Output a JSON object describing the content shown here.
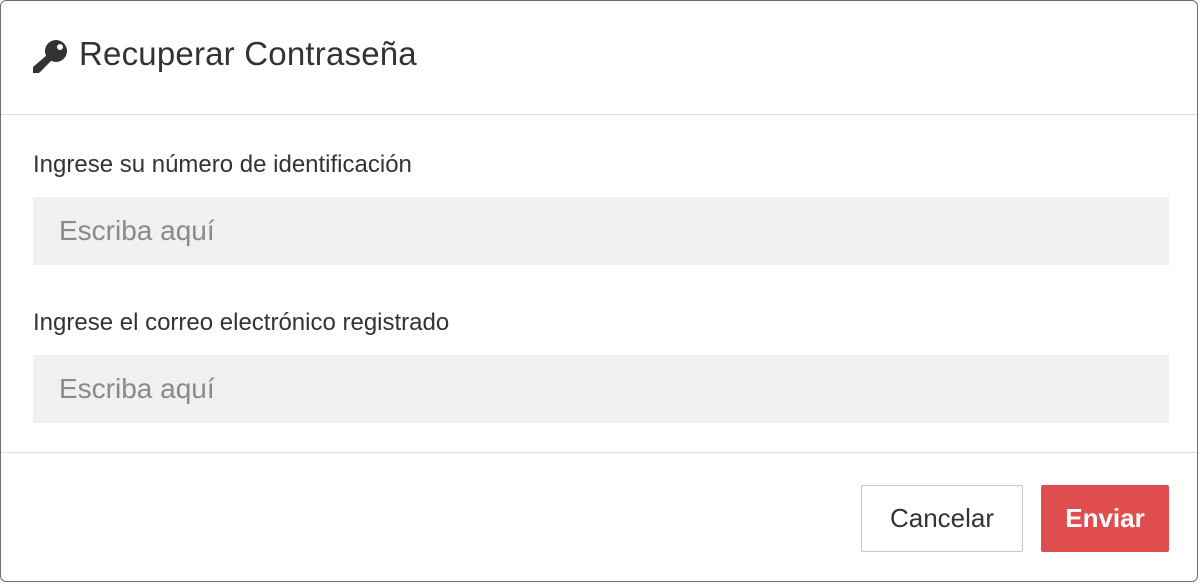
{
  "dialog": {
    "title": "Recuperar Contraseña",
    "title_icon": "key-icon"
  },
  "fields": [
    {
      "label": "Ingrese su número de identificación",
      "placeholder": "Escriba aquí",
      "value": ""
    },
    {
      "label": "Ingrese el correo electrónico registrado",
      "placeholder": "Escriba aquí",
      "value": ""
    }
  ],
  "footer": {
    "cancel_label": "Cancelar",
    "send_label": "Enviar"
  },
  "colors": {
    "primary_button": "#e04d4f",
    "input_background": "#eff0f0"
  }
}
